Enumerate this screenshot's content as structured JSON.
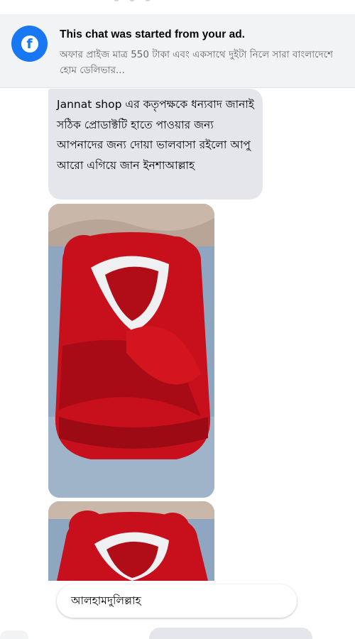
{
  "ad_banner": {
    "title": "This chat was started from your ad.",
    "subtitle": "অফার প্রাইজ মাত্র 550 টাকা এবং একসাথে দুইটা নিলে সারা বাংলাদেশে হোম ডেলিভার...",
    "icon": "facebook-icon",
    "brand_color": "#1877f2"
  },
  "messages": {
    "incoming_text": "Jannat shop এর কতৃপক্ষকে ধন্যবাদ জানাই সঠিক প্রোডাক্টটি হাতে পাওয়ার জন্য আপনাদের জন্য দোয়া ভালবাসা রইলো আপু আরো এগিয়ে জান ইনশাআল্লাহ",
    "photo_1": "red-hooded-baby-wrap-photo",
    "photo_2": "red-hooded-baby-wrap-photo",
    "reply_text": "আলহামদুলিল্লাহ"
  }
}
